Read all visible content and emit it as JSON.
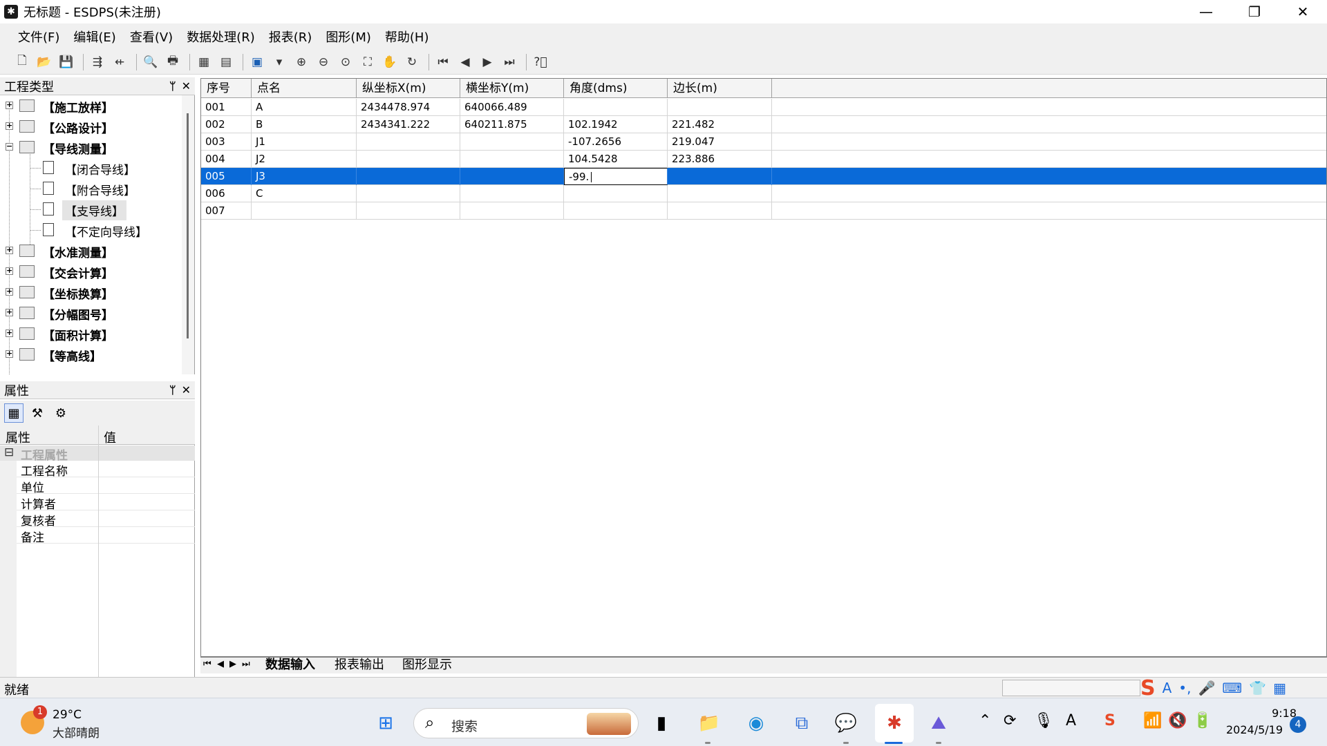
{
  "window": {
    "title": "无标题 - ESDPS(未注册)"
  },
  "menu": [
    "文件(F)",
    "编辑(E)",
    "查看(V)",
    "数据处理(R)",
    "报表(R)",
    "图形(M)",
    "帮助(H)"
  ],
  "tree_panel": {
    "title": "工程类型",
    "items": [
      {
        "label": "【施工放样】",
        "expander": "+"
      },
      {
        "label": "【公路设计】",
        "expander": "+"
      },
      {
        "label": "【导线测量】",
        "expander": "−"
      },
      {
        "label": "【闭合导线】"
      },
      {
        "label": "【附合导线】"
      },
      {
        "label": "【支导线】"
      },
      {
        "label": "【不定向导线】"
      },
      {
        "label": "【水准测量】",
        "expander": "+"
      },
      {
        "label": "【交会计算】",
        "expander": "+"
      },
      {
        "label": "【坐标换算】",
        "expander": "+"
      },
      {
        "label": "【分幅图号】",
        "expander": "+"
      },
      {
        "label": "【面积计算】",
        "expander": "+"
      },
      {
        "label": "【等高线】",
        "expander": "+"
      }
    ]
  },
  "props_panel": {
    "title": "属性",
    "col_property": "属性",
    "col_value": "值",
    "category": "工程属性",
    "category_expander": "⊟",
    "rows": [
      "工程名称",
      "单位",
      "计算者",
      "复核者",
      "备注"
    ]
  },
  "grid": {
    "headers": [
      "序号",
      "点名",
      "纵坐标X(m)",
      "横坐标Y(m)",
      "角度(dms)",
      "边长(m)"
    ],
    "rows": [
      [
        "001",
        "A",
        "2434478.974",
        "640066.489",
        "",
        ""
      ],
      [
        "002",
        "B",
        "2434341.222",
        "640211.875",
        "102.1942",
        "221.482"
      ],
      [
        "003",
        "J1",
        "",
        "",
        "-107.2656",
        "219.047"
      ],
      [
        "004",
        "J2",
        "",
        "",
        "104.5428",
        "223.886"
      ],
      [
        "005",
        "J3",
        "",
        "",
        "-99.",
        ""
      ],
      [
        "006",
        "C",
        "",
        "",
        "",
        ""
      ],
      [
        "007",
        "",
        "",
        "",
        "",
        ""
      ]
    ],
    "selected_row": 4
  },
  "sheet_tabs": [
    "数据输入",
    "报表输出",
    "图形显示"
  ],
  "status": {
    "text": "就绪"
  },
  "taskbar": {
    "weather_temp": "29°C",
    "weather_desc": "大部晴朗",
    "weather_badge": "1",
    "search_placeholder": "搜索",
    "time": "9:18",
    "date": "2024/5/19",
    "notification_count": "4"
  },
  "colors": {
    "selection": "#0a6ad8",
    "ime_logo": "#e84a27"
  }
}
